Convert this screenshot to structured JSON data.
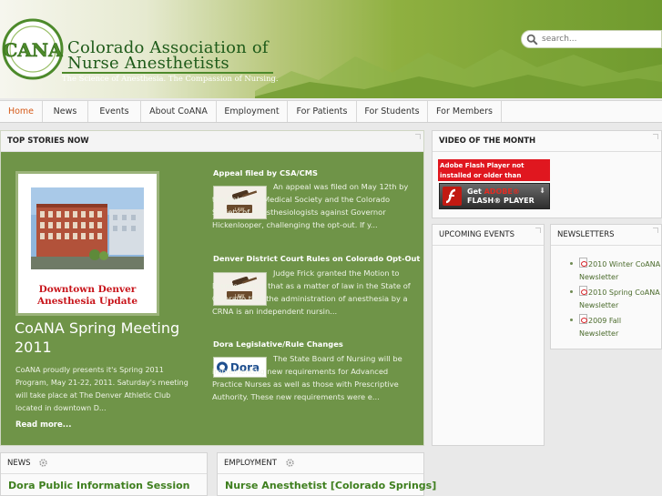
{
  "header": {
    "logo_letters": "CANA",
    "org_name_line1": "Colorado Association of",
    "org_name_line2": "Nurse Anesthetists",
    "tagline": "The Science of Anesthesia. The Compassion of Nursing.",
    "search_placeholder": "search..."
  },
  "nav": {
    "items": [
      {
        "label": "Home"
      },
      {
        "label": "News"
      },
      {
        "label": "Events"
      },
      {
        "label": "About CoANA"
      },
      {
        "label": "Employment"
      },
      {
        "label": "For Patients"
      },
      {
        "label": "For Students"
      },
      {
        "label": "For Members"
      }
    ]
  },
  "top_stories": {
    "heading": "TOP STORIES NOW",
    "feature": {
      "image_caption_line1": "Downtown Denver",
      "image_caption_line2": "Anesthesia Update",
      "title": "CoANA Spring Meeting 2011",
      "body": "CoANA proudly presents it's Spring 2011 Program, May 21-22, 2011. Saturday's meeting will take place at The Denver Athletic Club located in downtown D...",
      "read_more": "Read more..."
    },
    "stories": [
      {
        "title": "Appeal filed by CSA/CMS",
        "thumb": "LAW",
        "body": "An appeal was filed on May 12th by the Colorado Medical Society and the Colorado Society of Anesthesiologists against Governor Hickenlooper, challenging the opt-out. If y..."
      },
      {
        "title": "Denver District Court Rules on Colorado Opt-Out",
        "thumb": "LAW",
        "body": "Judge Frick granted the Motion to Dismiss ruling that as a matter of law in the State of Colorado that the administration of anesthesia by a CRNA is an independent nursin..."
      },
      {
        "title": "Dora Legislative/Rule Changes",
        "thumb": "Dora",
        "body": "The State Board of Nursing will be implementing new requirements for Advanced Practice Nurses as well as those with Prescriptive Authority.  These new requirements were e..."
      }
    ]
  },
  "video": {
    "heading": "VIDEO OF THE MONTH",
    "flash_note": "Adobe Flash Player not installed or older than 9.0.124!",
    "flash_btn_line1": "Get ",
    "flash_btn_adobe": "ADOBE®",
    "flash_btn_line2": "FLASH® PLAYER"
  },
  "upcoming": {
    "heading": "UPCOMING EVENTS"
  },
  "newsletters": {
    "heading": "NEWSLETTERS",
    "items": [
      {
        "label": "2010 Winter CoANA Newsletter"
      },
      {
        "label": "2010 Spring CoANA Newsletter"
      },
      {
        "label": "2009 Fall Newsletter"
      }
    ]
  },
  "news": {
    "heading": "NEWS",
    "title": "Dora Public Information Session"
  },
  "employment": {
    "heading": "EMPLOYMENT",
    "title": "Nurse Anesthetist [Colorado Springs]"
  },
  "colors": {
    "accent": "#d65b1a",
    "stories_bg": "#6f9448",
    "title_green": "#3e7f1e",
    "flash_red": "#e0171f"
  }
}
